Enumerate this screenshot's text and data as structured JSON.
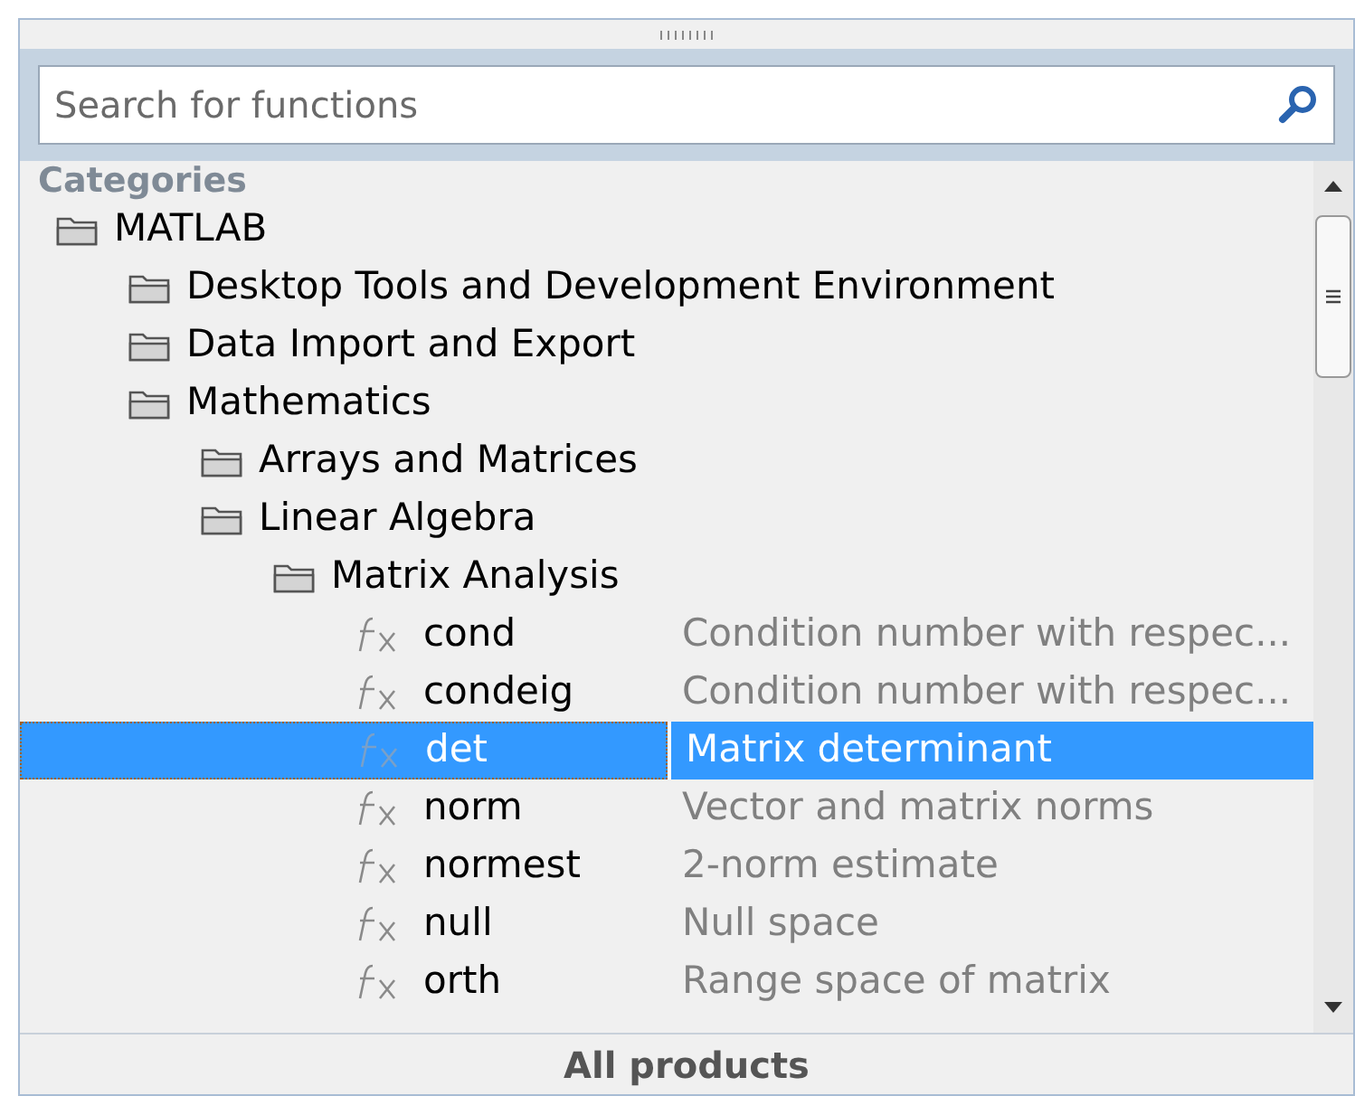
{
  "search": {
    "placeholder": "Search for functions"
  },
  "tree_header": "Categories",
  "tree": [
    {
      "kind": "folder",
      "label": "MATLAB",
      "children": [
        {
          "kind": "folder",
          "label": "Desktop Tools and Development Environment"
        },
        {
          "kind": "folder",
          "label": "Data Import and Export"
        },
        {
          "kind": "folder",
          "label": "Mathematics",
          "children": [
            {
              "kind": "folder",
              "label": "Arrays and Matrices"
            },
            {
              "kind": "folder",
              "label": "Linear Algebra",
              "children": [
                {
                  "kind": "folder",
                  "label": "Matrix Analysis",
                  "children": [
                    {
                      "kind": "function",
                      "label": "cond",
                      "description": "Condition number with respec...",
                      "selected": false
                    },
                    {
                      "kind": "function",
                      "label": "condeig",
                      "description": "Condition number with respec...",
                      "selected": false
                    },
                    {
                      "kind": "function",
                      "label": "det",
                      "description": "Matrix determinant",
                      "selected": true
                    },
                    {
                      "kind": "function",
                      "label": "norm",
                      "description": "Vector and matrix norms",
                      "selected": false
                    },
                    {
                      "kind": "function",
                      "label": "normest",
                      "description": "2-norm estimate",
                      "selected": false
                    },
                    {
                      "kind": "function",
                      "label": "null",
                      "description": "Null space",
                      "selected": false
                    },
                    {
                      "kind": "function",
                      "label": "orth",
                      "description": "Range space of matrix",
                      "selected": false
                    }
                  ]
                }
              ]
            }
          ]
        }
      ]
    }
  ],
  "footer": "All products"
}
